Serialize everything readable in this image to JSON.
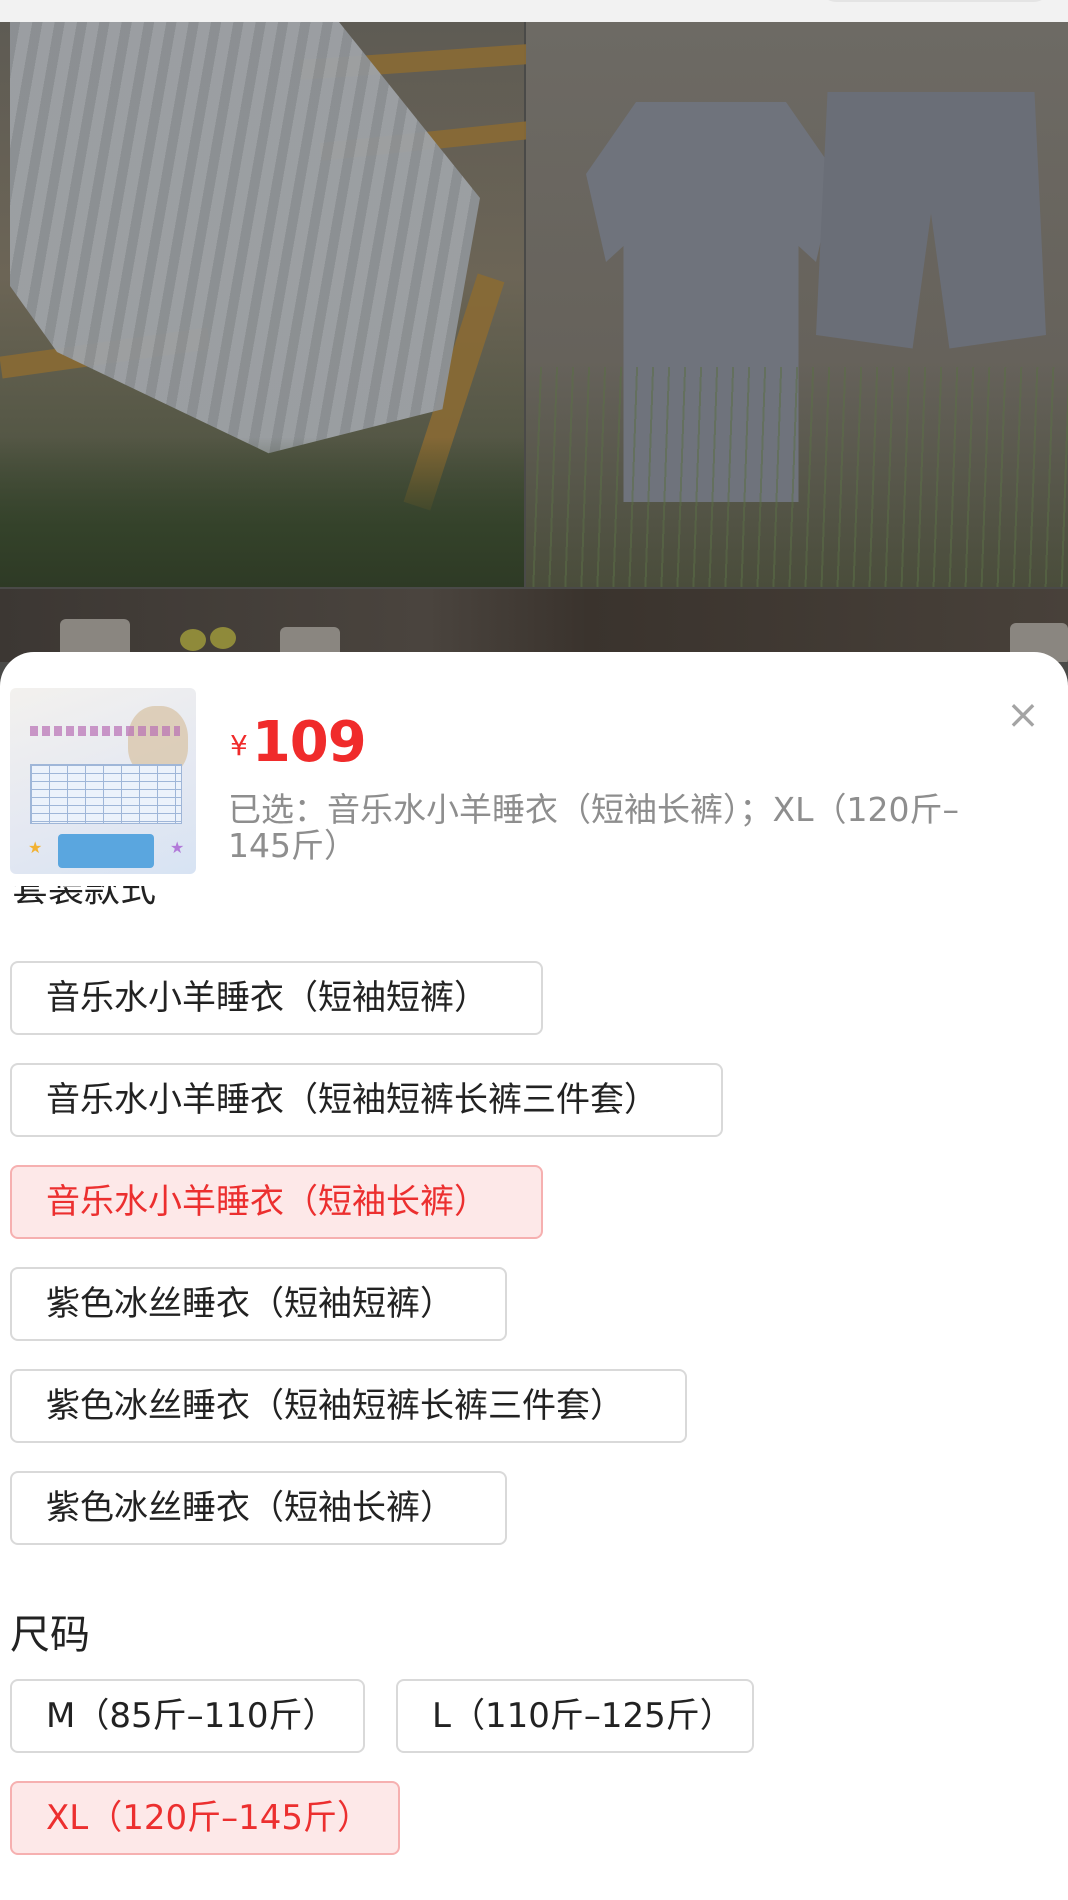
{
  "product": {
    "currency_symbol": "¥",
    "price": "109",
    "selected_text": "已选：音乐水小羊睡衣（短袖长裤）；XL（120斤–145斤）"
  },
  "style_section": {
    "title": "套装款式",
    "options": [
      {
        "label": "音乐水小羊睡衣（短袖短裤）",
        "selected": false
      },
      {
        "label": "音乐水小羊睡衣（短袖短裤长裤三件套）",
        "selected": false
      },
      {
        "label": "音乐水小羊睡衣（短袖长裤）",
        "selected": true
      },
      {
        "label": "紫色冰丝睡衣（短袖短裤）",
        "selected": false
      },
      {
        "label": "紫色冰丝睡衣（短袖短裤长裤三件套）",
        "selected": false
      },
      {
        "label": "紫色冰丝睡衣（短袖长裤）",
        "selected": false
      }
    ]
  },
  "size_section": {
    "title": "尺码",
    "options": [
      {
        "label": "M（85斤–110斤）",
        "selected": false
      },
      {
        "label": "L（110斤–125斤）",
        "selected": false
      },
      {
        "label": "XL（120斤–145斤）",
        "selected": true
      }
    ]
  },
  "colors": {
    "accent": "#f02b2b",
    "selected_bg": "#fde8e8",
    "selected_border": "#f6b0b0"
  },
  "icons": {
    "close": "close-icon"
  }
}
